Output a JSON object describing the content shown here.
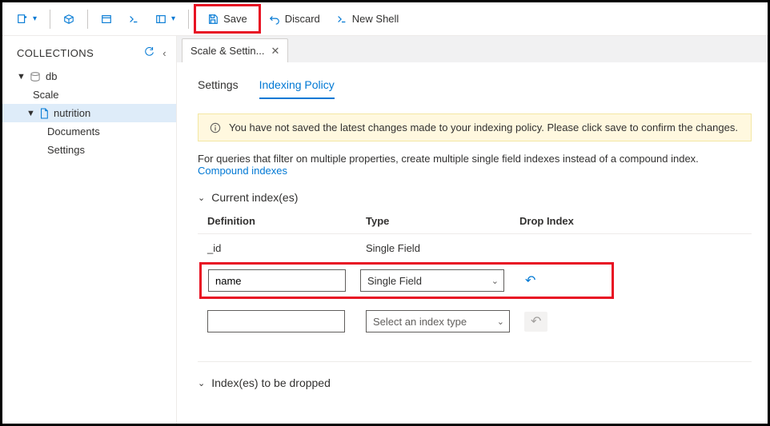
{
  "toolbar": {
    "save_label": "Save",
    "discard_label": "Discard",
    "newshell_label": "New Shell"
  },
  "sidebar": {
    "title": "COLLECTIONS",
    "tree": {
      "db": "db",
      "scale": "Scale",
      "nutrition": "nutrition",
      "documents": "Documents",
      "settings": "Settings"
    }
  },
  "tab": {
    "label": "Scale & Settin..."
  },
  "subtabs": {
    "settings": "Settings",
    "indexing": "Indexing Policy"
  },
  "notice": "You have not saved the latest changes made to your indexing policy. Please click save to confirm the changes.",
  "desc_text": "For queries that filter on multiple properties, create multiple single field indexes instead of a compound index. ",
  "desc_link": "Compound indexes",
  "sections": {
    "current": "Current index(es)",
    "dropped": "Index(es) to be dropped"
  },
  "columns": {
    "def": "Definition",
    "type": "Type",
    "drop": "Drop Index"
  },
  "rows": {
    "r1": {
      "def": "_id",
      "type": "Single Field"
    },
    "r2": {
      "def": "name",
      "type": "Single Field"
    },
    "r3": {
      "def": "",
      "type_placeholder": "Select an index type"
    }
  }
}
